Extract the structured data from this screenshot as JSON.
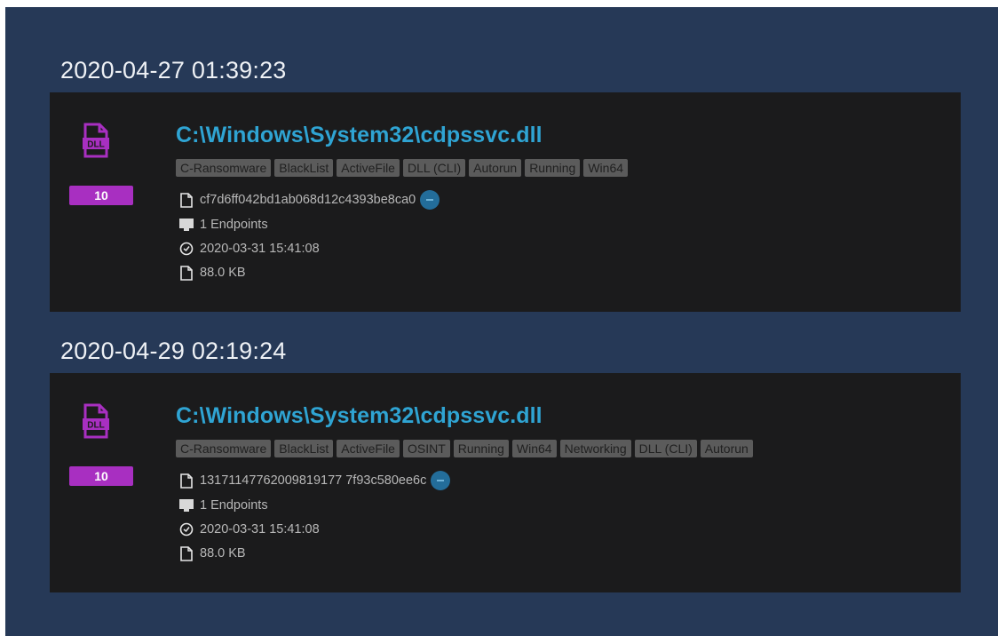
{
  "colors": {
    "background": "#263957",
    "card": "#1b1b1c",
    "path": "#2fa4d3",
    "score_badge": "#a82fc1",
    "dll_icon": "#a82fc1",
    "tag_bg": "#5b5b5b"
  },
  "groups": [
    {
      "timestamp": "2020-04-27 01:39:23",
      "item": {
        "icon": "dll-file-icon",
        "icon_label": "DLL",
        "score": "10",
        "path": "C:\\Windows\\System32\\cdpssvc.dll",
        "tags": [
          "C-Ransomware",
          "BlackList",
          "ActiveFile",
          "DLL (CLI)",
          "Autorun",
          "Running",
          "Win64"
        ],
        "hash": "cf7d6ff042bd1ab068d12c4393be8ca0",
        "endpoints": "1 Endpoints",
        "date": "2020-03-31 15:41:08",
        "size": "88.0 KB"
      }
    },
    {
      "timestamp": "2020-04-29 02:19:24",
      "item": {
        "icon": "dll-file-icon",
        "icon_label": "DLL",
        "score": "10",
        "path": "C:\\Windows\\System32\\cdpssvc.dll",
        "tags": [
          "C-Ransomware",
          "BlackList",
          "ActiveFile",
          "OSINT",
          "Running",
          "Win64",
          "Networking",
          "DLL (CLI)",
          "Autorun"
        ],
        "hash": "13171147762009819177 7f93c580ee6c",
        "endpoints": "1 Endpoints",
        "date": "2020-03-31 15:41:08",
        "size": "88.0 KB"
      }
    }
  ]
}
